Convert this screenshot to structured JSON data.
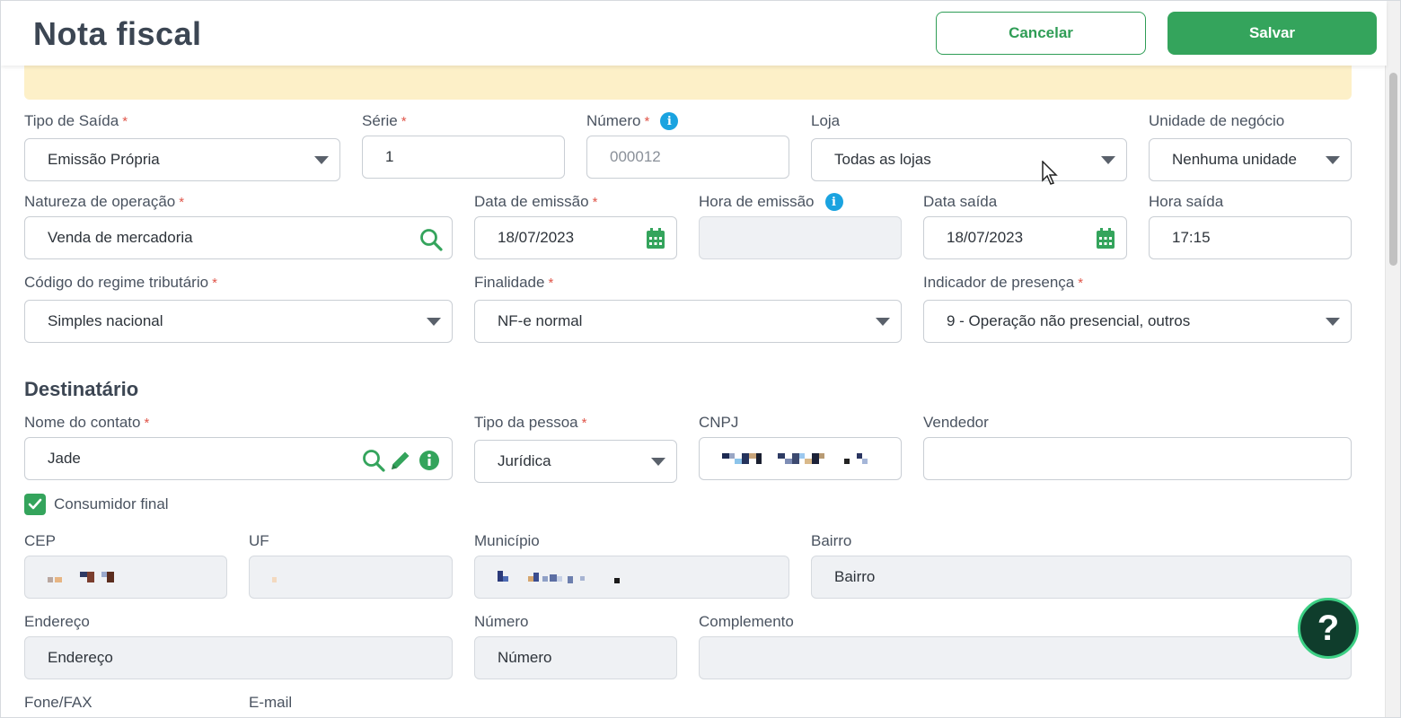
{
  "header": {
    "title": "Nota fiscal",
    "cancel_label": "Cancelar",
    "save_label": "Salvar"
  },
  "form": {
    "tipo_saida": {
      "label": "Tipo de Saída",
      "value": "Emissão Própria"
    },
    "serie": {
      "label": "Série",
      "value": "1"
    },
    "numero": {
      "label": "Número",
      "value": "000012"
    },
    "loja": {
      "label": "Loja",
      "value": "Todas as lojas"
    },
    "unidade_negocio": {
      "label": "Unidade de negócio",
      "value": "Nenhuma unidade"
    },
    "natureza_operacao": {
      "label": "Natureza de operação",
      "value": "Venda de mercadoria"
    },
    "data_emissao": {
      "label": "Data de emissão",
      "value": "18/07/2023"
    },
    "hora_emissao": {
      "label": "Hora de emissão",
      "value": ""
    },
    "data_saida": {
      "label": "Data saída",
      "value": "18/07/2023"
    },
    "hora_saida": {
      "label": "Hora saída",
      "value": "17:15"
    },
    "regime_tributario": {
      "label": "Código do regime tributário",
      "value": "Simples nacional"
    },
    "finalidade": {
      "label": "Finalidade",
      "value": "NF-e normal"
    },
    "indicador_presenca": {
      "label": "Indicador de presença",
      "value": "9 - Operação não presencial, outros"
    },
    "required_mark": "*"
  },
  "destinatario": {
    "section_title": "Destinatário",
    "nome_contato": {
      "label": "Nome do contato",
      "value": "Jade"
    },
    "tipo_pessoa": {
      "label": "Tipo da pessoa",
      "value": "Jurídica"
    },
    "cnpj": {
      "label": "CNPJ"
    },
    "vendedor": {
      "label": "Vendedor",
      "value": ""
    },
    "consumidor_final": {
      "label": "Consumidor final",
      "checked": true
    },
    "cep": {
      "label": "CEP"
    },
    "uf": {
      "label": "UF"
    },
    "municipio": {
      "label": "Município"
    },
    "bairro": {
      "label": "Bairro",
      "value": "Bairro"
    },
    "endereco": {
      "label": "Endereço",
      "value": "Endereço"
    },
    "numero": {
      "label": "Número",
      "value": "Número"
    },
    "complemento": {
      "label": "Complemento",
      "value": ""
    },
    "fone_fax": {
      "label": "Fone/FAX"
    },
    "email": {
      "label": "E-mail"
    }
  },
  "help": {
    "label": "?"
  },
  "icons": {
    "info": "info-icon",
    "search": "search-icon",
    "edit": "pencil-icon",
    "calendar": "calendar-icon",
    "dropdown": "chevron-down-icon",
    "check": "check-icon"
  },
  "colors": {
    "primary_green": "#34a45c",
    "info_blue": "#1aa3e0",
    "required_red": "#e0564a",
    "banner_yellow": "#fdf0c8",
    "help_dark": "#0f3d2c"
  }
}
